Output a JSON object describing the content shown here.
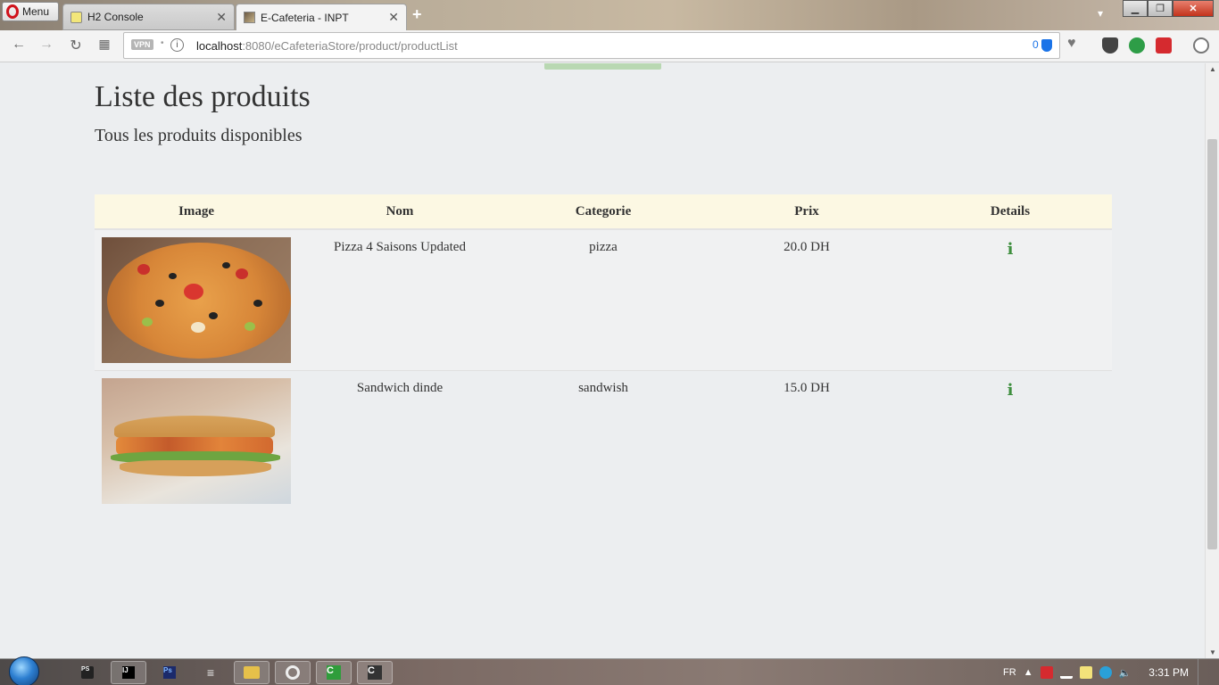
{
  "browser": {
    "menu_label": "Menu",
    "tabs": [
      {
        "label": "H2 Console",
        "active": false
      },
      {
        "label": "E-Cafeteria - INPT",
        "active": true
      }
    ],
    "vpn_label": "VPN",
    "url_host": "localhost",
    "url_path": ":8080/eCafeteriaStore/product/productList",
    "adblock_count": "0"
  },
  "page": {
    "title": "Liste des produits",
    "subtitle": "Tous les produits disponibles",
    "table": {
      "headers": [
        "Image",
        "Nom",
        "Categorie",
        "Prix",
        "Details"
      ],
      "rows": [
        {
          "image": "pizza",
          "name": "Pizza 4 Saisons Updated",
          "category": "pizza",
          "price": "20.0 DH",
          "details_icon": "info-icon"
        },
        {
          "image": "sandwich",
          "name": "Sandwich dinde",
          "category": "sandwish",
          "price": "15.0 DH",
          "details_icon": "info-icon"
        }
      ]
    }
  },
  "taskbar": {
    "items": [
      "PS",
      "IJ",
      "Ps",
      "menu",
      "folder",
      "opera",
      "C",
      "C"
    ],
    "language": "FR",
    "clock": "3:31 PM"
  },
  "colors": {
    "table_header_bg": "#fcf8e3",
    "info_icon": "#3f8f3f",
    "page_bg": "#eceef0"
  }
}
